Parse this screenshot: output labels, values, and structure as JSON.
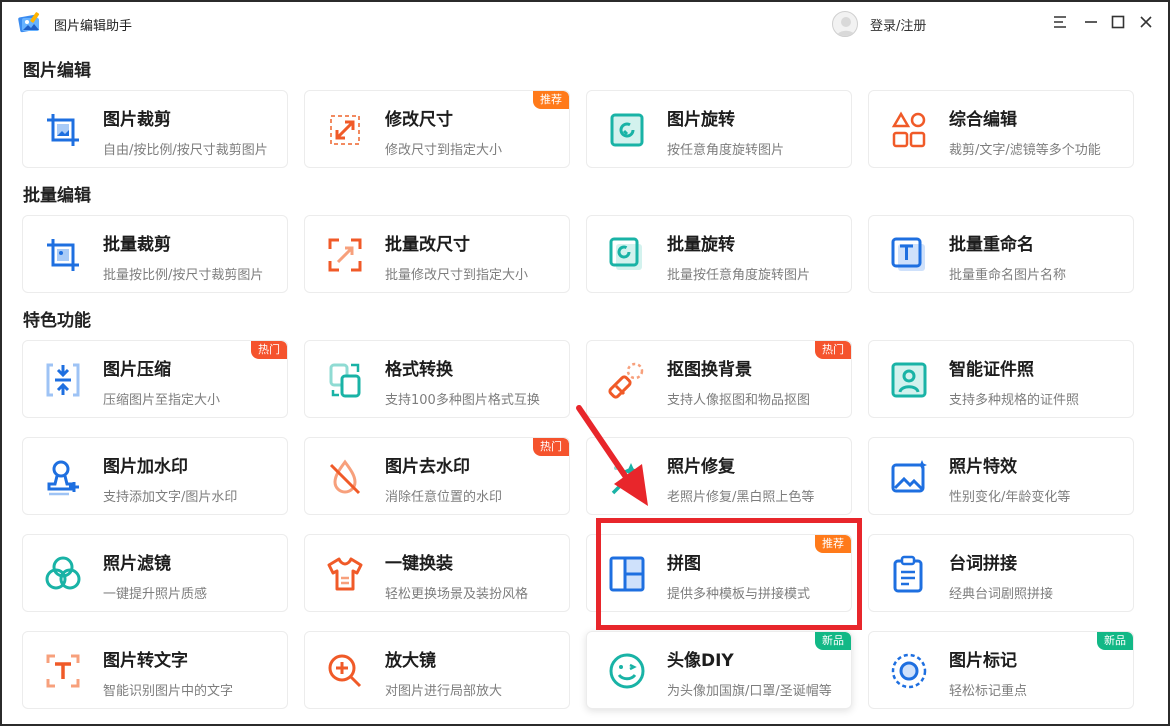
{
  "app": {
    "title": "图片编辑助手",
    "login_label": "登录/注册"
  },
  "window_controls": [
    "menu-icon",
    "minimize-icon",
    "maximize-icon",
    "close-icon"
  ],
  "colors": {
    "blue": "#1e6fe0",
    "orange": "#f05a28",
    "teal": "#19b3a6",
    "badge_orange": "#ff7a1a",
    "badge_red": "#f5532d",
    "badge_green": "#12b886",
    "highlight": "#e8262b"
  },
  "sections": [
    {
      "title": "图片编辑"
    },
    {
      "title": "批量编辑"
    },
    {
      "title": "特色功能"
    }
  ],
  "cards": [
    {
      "title": "图片裁剪",
      "desc": "自由/按比例/按尺寸裁剪图片",
      "icon": "crop-icon",
      "badge": ""
    },
    {
      "title": "修改尺寸",
      "desc": "修改尺寸到指定大小",
      "icon": "resize-icon",
      "badge": "推荐"
    },
    {
      "title": "图片旋转",
      "desc": "按任意角度旋转图片",
      "icon": "rotate-icon",
      "badge": ""
    },
    {
      "title": "综合编辑",
      "desc": "裁剪/文字/滤镜等多个功能",
      "icon": "shapes-icon",
      "badge": ""
    },
    {
      "title": "批量裁剪",
      "desc": "批量按比例/按尺寸裁剪图片",
      "icon": "batch-crop-icon",
      "badge": ""
    },
    {
      "title": "批量改尺寸",
      "desc": "批量修改尺寸到指定大小",
      "icon": "batch-resize-icon",
      "badge": ""
    },
    {
      "title": "批量旋转",
      "desc": "批量按任意角度旋转图片",
      "icon": "batch-rotate-icon",
      "badge": ""
    },
    {
      "title": "批量重命名",
      "desc": "批量重命名图片名称",
      "icon": "rename-icon",
      "badge": ""
    },
    {
      "title": "图片压缩",
      "desc": "压缩图片至指定大小",
      "icon": "compress-icon",
      "badge": "热门"
    },
    {
      "title": "格式转换",
      "desc": "支持100多种图片格式互换",
      "icon": "convert-icon",
      "badge": ""
    },
    {
      "title": "抠图换背景",
      "desc": "支持人像抠图和物品抠图",
      "icon": "cutout-icon",
      "badge": "热门"
    },
    {
      "title": "智能证件照",
      "desc": "支持多种规格的证件照",
      "icon": "id-photo-icon",
      "badge": ""
    },
    {
      "title": "图片加水印",
      "desc": "支持添加文字/图片水印",
      "icon": "add-watermark-icon",
      "badge": ""
    },
    {
      "title": "图片去水印",
      "desc": "消除任意位置的水印",
      "icon": "remove-watermark-icon",
      "badge": "热门"
    },
    {
      "title": "照片修复",
      "desc": "老照片修复/黑白照上色等",
      "icon": "magic-wand-icon",
      "badge": ""
    },
    {
      "title": "照片特效",
      "desc": "性别变化/年龄变化等",
      "icon": "effects-icon",
      "badge": ""
    },
    {
      "title": "照片滤镜",
      "desc": "一键提升照片质感",
      "icon": "filter-icon",
      "badge": ""
    },
    {
      "title": "一键换装",
      "desc": "轻松更换场景及装扮风格",
      "icon": "shirt-icon",
      "badge": ""
    },
    {
      "title": "拼图",
      "desc": "提供多种模板与拼接模式",
      "icon": "collage-icon",
      "badge": "推荐"
    },
    {
      "title": "台词拼接",
      "desc": "经典台词剧照拼接",
      "icon": "clipboard-icon",
      "badge": ""
    },
    {
      "title": "图片转文字",
      "desc": "智能识别图片中的文字",
      "icon": "ocr-icon",
      "badge": ""
    },
    {
      "title": "放大镜",
      "desc": "对图片进行局部放大",
      "icon": "magnifier-icon",
      "badge": ""
    },
    {
      "title": "头像DIY",
      "desc": "为头像加国旗/口罩/圣诞帽等",
      "icon": "face-icon",
      "badge": "新品"
    },
    {
      "title": "图片标记",
      "desc": "轻松标记重点",
      "icon": "marker-icon",
      "badge": "新品"
    }
  ]
}
